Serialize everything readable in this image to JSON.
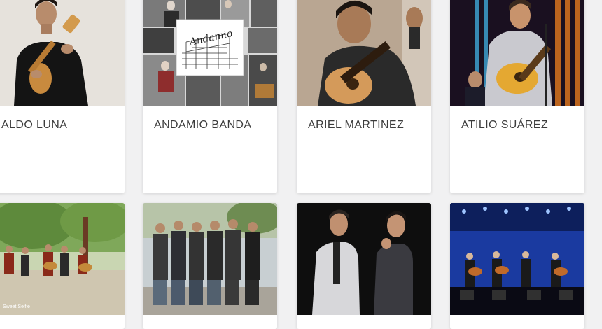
{
  "artists": [
    {
      "name": "ALDO LUNA",
      "photo": "man-playing-charango-photo"
    },
    {
      "name": "ANDAMIO BANDA",
      "photo": "band-collage-photo"
    },
    {
      "name": "ARIEL MARTINEZ",
      "photo": "man-playing-guitar-photo"
    },
    {
      "name": "ATILIO SUÁREZ",
      "photo": "singer-on-stage-photo"
    },
    {
      "name": "",
      "photo": "musicians-outdoor-park-photo"
    },
    {
      "name": "",
      "photo": "group-standing-outdoors-photo"
    },
    {
      "name": "",
      "photo": "two-men-in-suits-photo"
    },
    {
      "name": "",
      "photo": "band-on-blue-stage-photo"
    }
  ],
  "collage_logo_text": "Andamio",
  "photo_watermark": "Sweet Selfie",
  "colors": {
    "page_bg": "#f1f1f2",
    "card_bg": "#ffffff",
    "name_text": "#3c3c3c"
  }
}
